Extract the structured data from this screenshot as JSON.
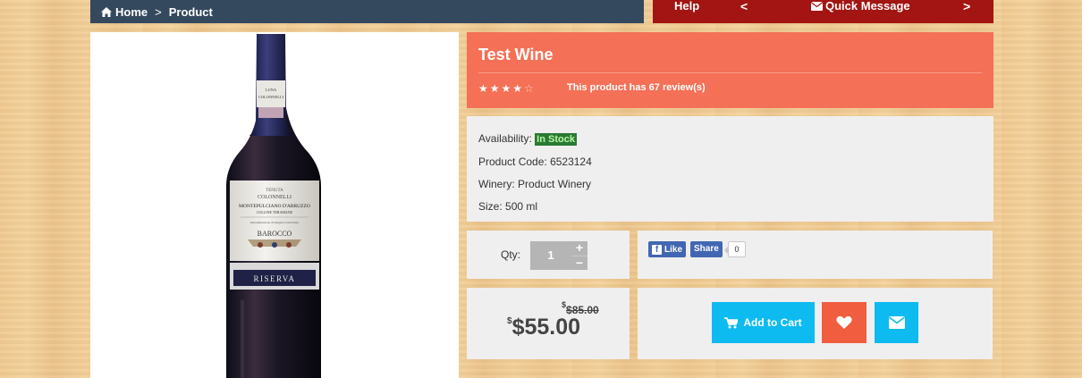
{
  "breadcrumb": {
    "home": "Home",
    "separator": ">",
    "current": "Product",
    "home_icon": "home-icon"
  },
  "help_bar": {
    "help": "Help",
    "prev": "<",
    "quick_message": "Quick Message",
    "next": ">",
    "icon": "envelope-icon"
  },
  "product": {
    "title": "Test Wine",
    "rating": 4,
    "rating_max": 5,
    "reviews_text": "This product has 67 review(s)",
    "availability_label": "Availability:",
    "availability_value": "In Stock",
    "code_label": "Product Code:",
    "code_value": "6523124",
    "winery_label": "Winery:",
    "winery_value": "Product Winery",
    "size_label": "Size:",
    "size_value": "500 ml",
    "image_icon": "wine-bottle-image",
    "bottle_label": {
      "top": "MONTEPULCIANO D'ABRUZZO",
      "sub": "COLLINE TERAMANE",
      "name": "BAROCCO",
      "band": "RISERVA"
    }
  },
  "quantity": {
    "label": "Qty:",
    "value": "1",
    "plus": "+",
    "minus": "−"
  },
  "social": {
    "like": "Like",
    "share": "Share",
    "share_count": "0"
  },
  "price": {
    "currency": "$",
    "old": "$85.00",
    "current": "$55.00"
  },
  "actions": {
    "add_to_cart": "Add to Cart",
    "cart_icon": "cart-icon",
    "wishlist_icon": "heart-icon",
    "message_icon": "envelope-icon"
  },
  "colors": {
    "breadcrumb_bg": "#34495e",
    "help_bg": "#a31512",
    "title_bg": "#f47056",
    "panel_bg": "#efefef",
    "stock_bg": "#2a7a34",
    "cart_bg": "#0dbbf0",
    "wish_bg": "#f15d3f"
  }
}
